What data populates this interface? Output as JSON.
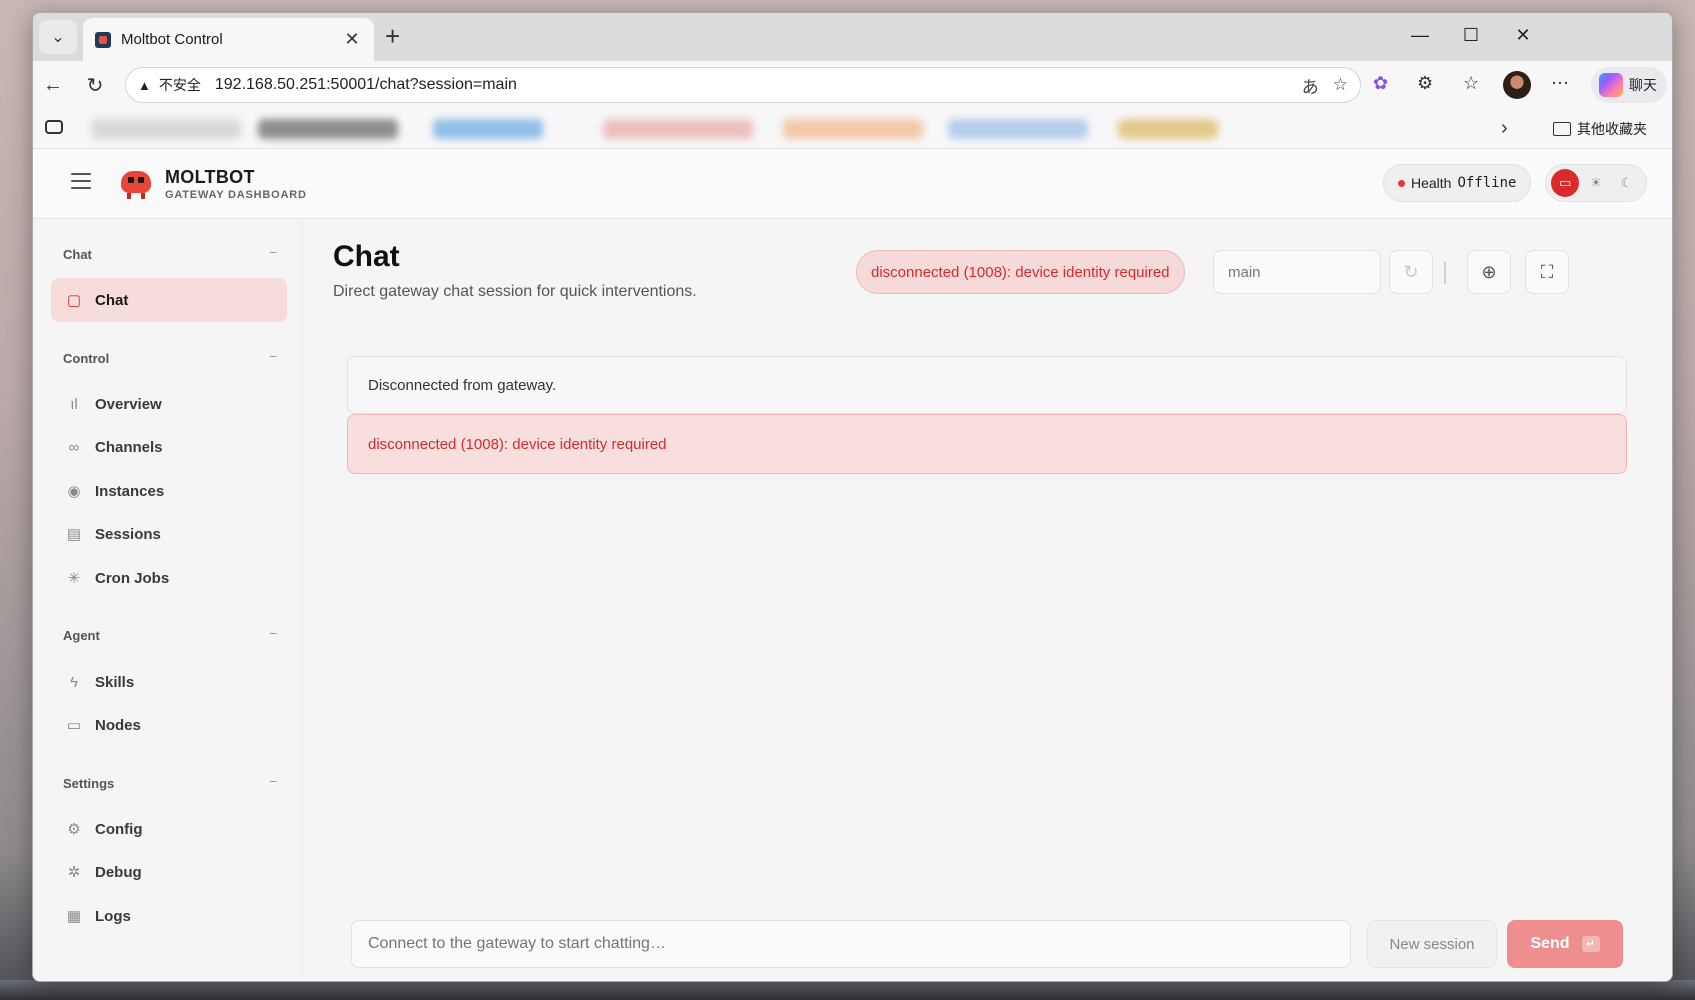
{
  "browser": {
    "tab_title": "Moltbot Control",
    "new_tab_glyph": "+",
    "insecure_label": "不安全",
    "url": "192.168.50.251:50001/chat?session=main",
    "copilot_label": "聊天",
    "bookmarks_folder": "其他收藏夹"
  },
  "app": {
    "brand_title": "MOLTBOT",
    "brand_subtitle": "GATEWAY DASHBOARD",
    "health_label": "Health",
    "health_value": "Offline"
  },
  "sidebar": {
    "sections": [
      {
        "title": "Chat",
        "collapse": "−",
        "items": [
          {
            "label": "Chat",
            "icon": "chat-bubble-icon"
          }
        ]
      },
      {
        "title": "Control",
        "collapse": "−",
        "items": [
          {
            "label": "Overview",
            "icon": "bar-chart-icon"
          },
          {
            "label": "Channels",
            "icon": "link-icon"
          },
          {
            "label": "Instances",
            "icon": "radio-icon"
          },
          {
            "label": "Sessions",
            "icon": "document-icon"
          },
          {
            "label": "Cron Jobs",
            "icon": "loader-icon"
          }
        ]
      },
      {
        "title": "Agent",
        "collapse": "−",
        "items": [
          {
            "label": "Skills",
            "icon": "lightning-icon"
          },
          {
            "label": "Nodes",
            "icon": "monitor-icon"
          }
        ]
      },
      {
        "title": "Settings",
        "collapse": "−",
        "items": [
          {
            "label": "Config",
            "icon": "gear-icon"
          },
          {
            "label": "Debug",
            "icon": "bug-icon"
          },
          {
            "label": "Logs",
            "icon": "log-icon"
          }
        ]
      }
    ]
  },
  "main": {
    "title": "Chat",
    "subtitle": "Direct gateway chat session for quick interventions.",
    "error_pill": "disconnected (1008): device identity required",
    "session_value": "main",
    "messages": [
      {
        "kind": "info",
        "text": "Disconnected from gateway."
      },
      {
        "kind": "error",
        "text": "disconnected (1008): device identity required"
      }
    ],
    "composer_placeholder": "Connect to the gateway to start chatting…",
    "new_session_label": "New session",
    "send_label": "Send"
  },
  "colors": {
    "accent": "#d92b2b",
    "error_text": "#d52b2b",
    "error_bg": "#f9dede",
    "send_bg": "#ef8e8e"
  }
}
